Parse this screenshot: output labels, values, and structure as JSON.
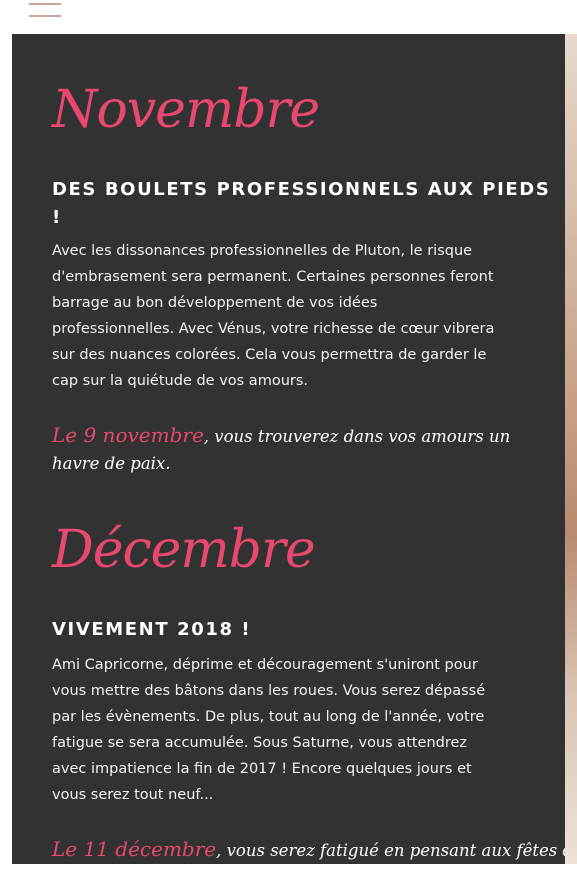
{
  "header": {
    "menu_icon": "hamburger-menu-icon"
  },
  "sections": [
    {
      "month": "Novembre",
      "headline": "DES BOULETS PROFESSIONNELS AUX PIEDS !",
      "body": "Avec les dissonances professionnelles de Pluton, le risque d'embrasement sera permanent. Certaines personnes feront barrage au bon développement de vos idées professionnelles. Avec Vénus, votre richesse de cœur vibrera sur des nuances colorées. Cela vous permettra de garder le cap sur la quiétude de vos amours.",
      "quote_date": "Le 9 novembre",
      "quote_text": ", vous trouverez dans vos amours un havre de paix."
    },
    {
      "month": "Décembre",
      "headline": "VIVEMENT 2018 !",
      "body": "Ami Capricorne, déprime et découragement s'uniront pour vous mettre des bâtons dans les roues. Vous serez dépassé par les évènements. De plus, tout au long de l'année, votre fatigue se sera accumulée. Sous Saturne, vous attendrez avec impatience la fin de 2017 ! Encore quelques jours et vous serez tout neuf...",
      "quote_date": "Le 11 décembre",
      "quote_text": ", vous serez fatigué en pensant aux fêtes de"
    }
  ],
  "colors": {
    "accent": "#e8486e",
    "panel": "#323232",
    "menu": "#c9a799"
  }
}
